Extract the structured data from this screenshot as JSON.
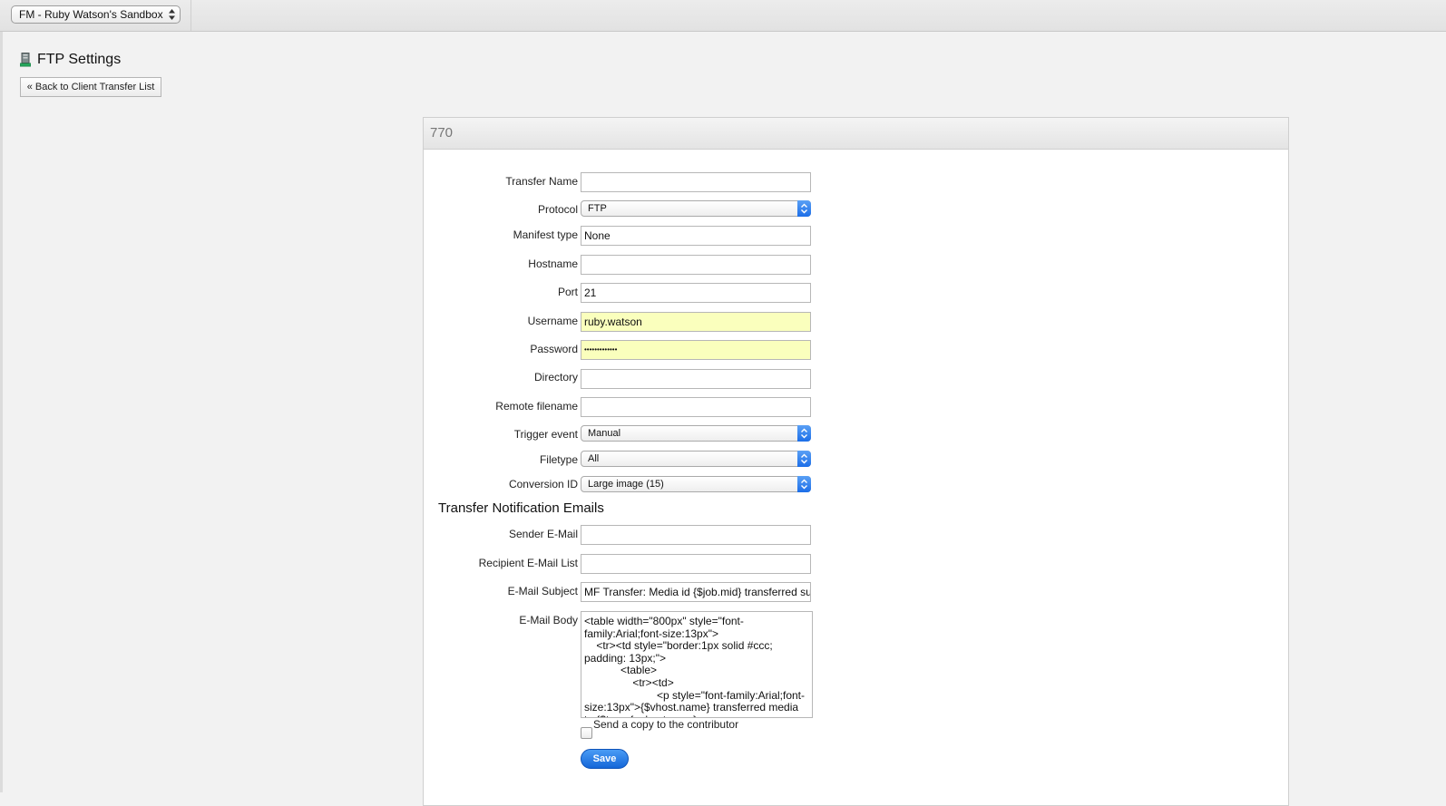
{
  "topbar": {
    "workspace_select": "FM - Ruby Watson's Sandbox"
  },
  "page": {
    "title": "FTP Settings",
    "back_button": "« Back to Client Transfer List"
  },
  "panel": {
    "header": "770"
  },
  "form": {
    "transfer_name": {
      "label": "Transfer Name",
      "value": ""
    },
    "protocol": {
      "label": "Protocol",
      "value": "FTP"
    },
    "manifest_type": {
      "label": "Manifest type",
      "value": "None"
    },
    "hostname": {
      "label": "Hostname",
      "value": ""
    },
    "port": {
      "label": "Port",
      "value": "21"
    },
    "username": {
      "label": "Username",
      "value": "ruby.watson"
    },
    "password": {
      "label": "Password",
      "value": "•••••••••••••"
    },
    "directory": {
      "label": "Directory",
      "value": ""
    },
    "remote_filename": {
      "label": "Remote filename",
      "value": ""
    },
    "trigger_event": {
      "label": "Trigger event",
      "value": "Manual"
    },
    "filetype": {
      "label": "Filetype",
      "value": "All"
    },
    "conversion_id": {
      "label": "Conversion ID",
      "value": "Large image (15)"
    }
  },
  "notifications": {
    "section_title": "Transfer Notification Emails",
    "sender_email": {
      "label": "Sender E-Mail",
      "value": ""
    },
    "recipient_list": {
      "label": "Recipient E-Mail List",
      "value": ""
    },
    "subject": {
      "label": "E-Mail Subject",
      "value": "MF Transfer: Media id {$job.mid} transferred su"
    },
    "body": {
      "label": "E-Mail Body",
      "value": "<table width=\"800px\" style=\"font-family:Arial;font-size:13px\">\n    <tr><td style=\"border:1px solid #ccc; padding: 13px;\">\n            <table>\n                <tr><td>\n                        <p style=\"font-family:Arial;font-size:13px\">{$vhost.name} transferred media to {$transfer.hostname} ..."
    },
    "copy_checkbox_label": "Send a copy to the contributor",
    "save_button": "Save"
  },
  "colors": {
    "autofill_yellow": "#faffbd",
    "primary_blue": "#1466d8"
  }
}
